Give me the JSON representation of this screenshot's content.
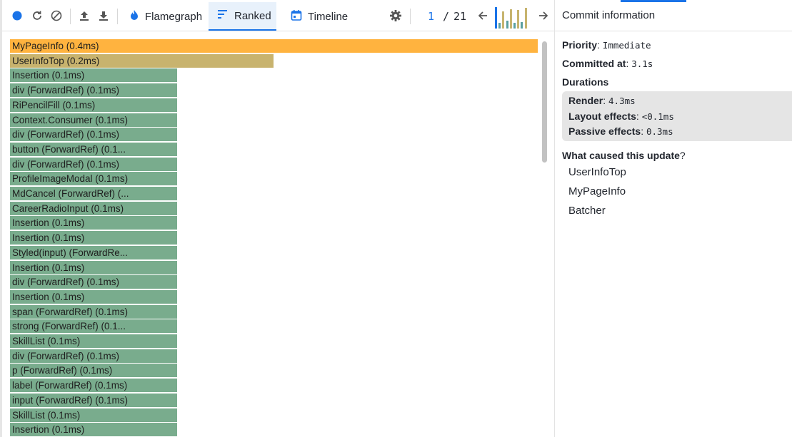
{
  "toolbar": {
    "icons": [
      "record-icon",
      "reload-icon",
      "clear-icon",
      "upload-icon",
      "download-icon",
      "settings-icon",
      "prev-arrow-icon",
      "next-arrow-icon"
    ],
    "tabs": [
      {
        "label": "Flamegraph",
        "icon": "flame-icon"
      },
      {
        "label": "Ranked",
        "icon": "ranked-icon"
      },
      {
        "label": "Timeline",
        "icon": "calendar-icon"
      }
    ],
    "active_tab": "Ranked",
    "commit_current": "1",
    "commit_separator": "/",
    "commit_total": "21",
    "commit_bars": [
      {
        "level": 1.0,
        "color": "#1a73e8"
      },
      {
        "level": 0.25,
        "color": "#5aa0a0"
      },
      {
        "level": 0.8,
        "color": "#c7b46e"
      },
      {
        "level": 0.35,
        "color": "#5aa0a0"
      },
      {
        "level": 0.9,
        "color": "#c7b46e"
      },
      {
        "level": 0.25,
        "color": "#5aa0a0"
      },
      {
        "level": 0.85,
        "color": "#c7b46e"
      },
      {
        "level": 0.3,
        "color": "#5aa0a0"
      },
      {
        "level": 0.95,
        "color": "#c7b46e"
      }
    ]
  },
  "ranked": {
    "colors": {
      "top": "#ffb33f",
      "second": "#c8b36e",
      "rest": "#79ac8d"
    },
    "items": [
      {
        "label": "MyPageInfo (0.4ms)",
        "value": 0.4,
        "tier": "top"
      },
      {
        "label": "UserInfoTop (0.2ms)",
        "value": 0.2,
        "tier": "second"
      },
      {
        "label": "Insertion (0.1ms)",
        "value": 0.1,
        "tier": "rest"
      },
      {
        "label": "div (ForwardRef) (0.1ms)",
        "value": 0.1,
        "tier": "rest"
      },
      {
        "label": "RiPencilFill (0.1ms)",
        "value": 0.1,
        "tier": "rest"
      },
      {
        "label": "Context.Consumer (0.1ms)",
        "value": 0.1,
        "tier": "rest"
      },
      {
        "label": "div (ForwardRef) (0.1ms)",
        "value": 0.1,
        "tier": "rest"
      },
      {
        "label": "button (ForwardRef) (0.1...",
        "value": 0.1,
        "tier": "rest"
      },
      {
        "label": "div (ForwardRef) (0.1ms)",
        "value": 0.1,
        "tier": "rest"
      },
      {
        "label": "ProfileImageModal (0.1ms)",
        "value": 0.1,
        "tier": "rest"
      },
      {
        "label": "MdCancel (ForwardRef) (...",
        "value": 0.1,
        "tier": "rest"
      },
      {
        "label": "CareerRadioInput (0.1ms)",
        "value": 0.1,
        "tier": "rest"
      },
      {
        "label": "Insertion (0.1ms)",
        "value": 0.1,
        "tier": "rest"
      },
      {
        "label": "Insertion (0.1ms)",
        "value": 0.1,
        "tier": "rest"
      },
      {
        "label": "Styled(input) (ForwardRe...",
        "value": 0.1,
        "tier": "rest"
      },
      {
        "label": "Insertion (0.1ms)",
        "value": 0.1,
        "tier": "rest"
      },
      {
        "label": "div (ForwardRef) (0.1ms)",
        "value": 0.1,
        "tier": "rest"
      },
      {
        "label": "Insertion (0.1ms)",
        "value": 0.1,
        "tier": "rest"
      },
      {
        "label": "span (ForwardRef) (0.1ms)",
        "value": 0.1,
        "tier": "rest"
      },
      {
        "label": "strong (ForwardRef) (0.1...",
        "value": 0.1,
        "tier": "rest"
      },
      {
        "label": "SkillList (0.1ms)",
        "value": 0.1,
        "tier": "rest"
      },
      {
        "label": "div (ForwardRef) (0.1ms)",
        "value": 0.1,
        "tier": "rest"
      },
      {
        "label": "p (ForwardRef) (0.1ms)",
        "value": 0.1,
        "tier": "rest"
      },
      {
        "label": "label (ForwardRef) (0.1ms)",
        "value": 0.1,
        "tier": "rest"
      },
      {
        "label": "input (ForwardRef) (0.1ms)",
        "value": 0.1,
        "tier": "rest"
      },
      {
        "label": "SkillList (0.1ms)",
        "value": 0.1,
        "tier": "rest"
      },
      {
        "label": "Insertion (0.1ms)",
        "value": 0.1,
        "tier": "rest"
      }
    ]
  },
  "commit_info": {
    "title": "Commit information",
    "priority_label": "Priority",
    "priority_value": "Immediate",
    "committed_label": "Committed at",
    "committed_value": "3.1s",
    "durations_label": "Durations",
    "render_label": "Render",
    "render_value": "4.3ms",
    "layout_label": "Layout effects",
    "layout_value": "<0.1ms",
    "passive_label": "Passive effects",
    "passive_value": "0.3ms",
    "cause_label": "What caused this update",
    "cause_qmark": "?",
    "causes": [
      "UserInfoTop",
      "MyPageInfo",
      "Batcher"
    ]
  }
}
